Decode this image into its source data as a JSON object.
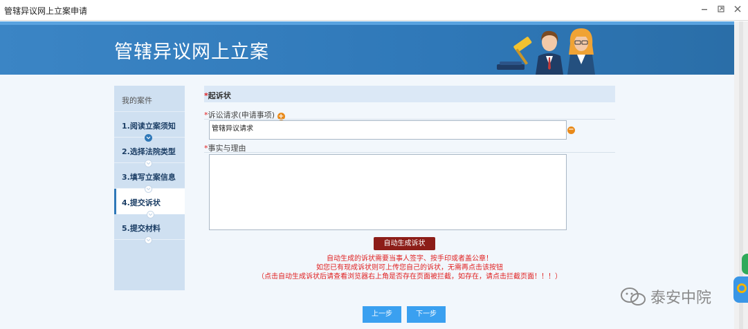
{
  "window": {
    "title": "管辖异议网上立案申请"
  },
  "banner": {
    "title": "管辖异议网上立案"
  },
  "sidebar": {
    "header": "我的案件",
    "steps": [
      {
        "label": "1.阅读立案须知",
        "done": true
      },
      {
        "label": "2.选择法院类型",
        "done": false
      },
      {
        "label": "3.填写立案信息",
        "done": false
      },
      {
        "label": "4.提交诉状",
        "done": false,
        "active": true
      },
      {
        "label": "5.提交材料",
        "done": false
      }
    ]
  },
  "form": {
    "section_title": "起诉状",
    "required_mark": "*",
    "claims_label": "诉讼请求(申请事项)",
    "claims_value": "管辖异议请求",
    "facts_label": "事实与理由",
    "facts_value": "",
    "generate_button": "自动生成诉状",
    "notes": [
      "自动生成的诉状需要当事人签字、按手印或者盖公章！",
      "如您已有现成诉状则可上传您自己的诉状，无需再点击该按钮",
      "（点击自动生成诉状后请查看浏览器右上角是否存在页面被拦截，如存在，请点击拦截页面！！！）"
    ]
  },
  "nav": {
    "prev_label": "上一步",
    "next_label": "下一步"
  },
  "watermark": {
    "text": "泰安中院"
  },
  "colors": {
    "banner": "#2f78b8",
    "sidebar": "#cfe0f1",
    "generate_button": "#8c1d18",
    "nav_button": "#3aa0f0",
    "note_text": "#e02020"
  }
}
